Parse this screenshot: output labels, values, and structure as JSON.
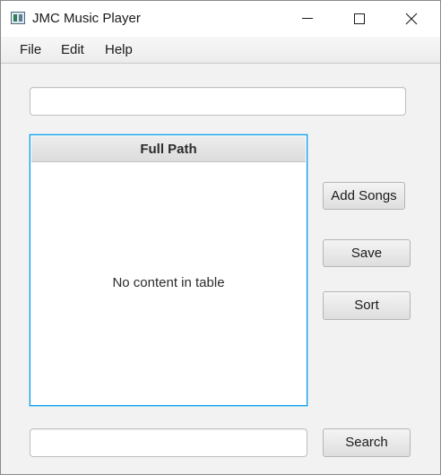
{
  "window": {
    "title": "JMC Music Player",
    "icons": {
      "app": "app-icon",
      "minimize": "minimize-icon",
      "maximize": "maximize-icon",
      "close": "close-icon"
    }
  },
  "menubar": {
    "items": [
      "File",
      "Edit",
      "Help"
    ]
  },
  "top_field": {
    "value": ""
  },
  "table": {
    "columns": [
      "Full Path"
    ],
    "placeholder": "No content in table",
    "rows": []
  },
  "buttons": {
    "add_songs": "Add Songs",
    "save": "Save",
    "sort": "Sort",
    "search": "Search"
  },
  "search_field": {
    "value": ""
  },
  "colors": {
    "focus_border": "#039be5",
    "window_bg": "#f2f2f2"
  }
}
